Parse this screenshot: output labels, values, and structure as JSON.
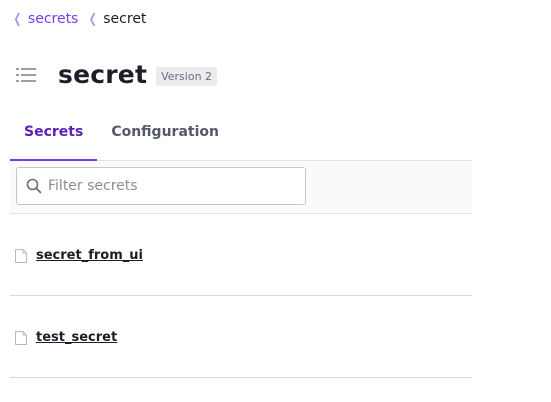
{
  "breadcrumb": {
    "items": [
      {
        "label": "secrets",
        "link": true
      },
      {
        "label": "secret",
        "link": false
      }
    ]
  },
  "header": {
    "title": "secret",
    "version_badge": "Version 2"
  },
  "tabs": [
    {
      "label": "Secrets",
      "active": true
    },
    {
      "label": "Configuration",
      "active": false
    }
  ],
  "filter": {
    "placeholder": "Filter secrets",
    "value": ""
  },
  "secrets": [
    {
      "name": "secret_from_ui"
    },
    {
      "name": "test_secret"
    }
  ],
  "icons": {
    "breadcrumb_separator": "chevron-left-icon",
    "title": "list-icon",
    "filter": "search-icon",
    "row": "document-icon"
  },
  "colors": {
    "accent": "#7c3aed",
    "accent_dark": "#5b21b6",
    "text": "#1f1d28"
  }
}
